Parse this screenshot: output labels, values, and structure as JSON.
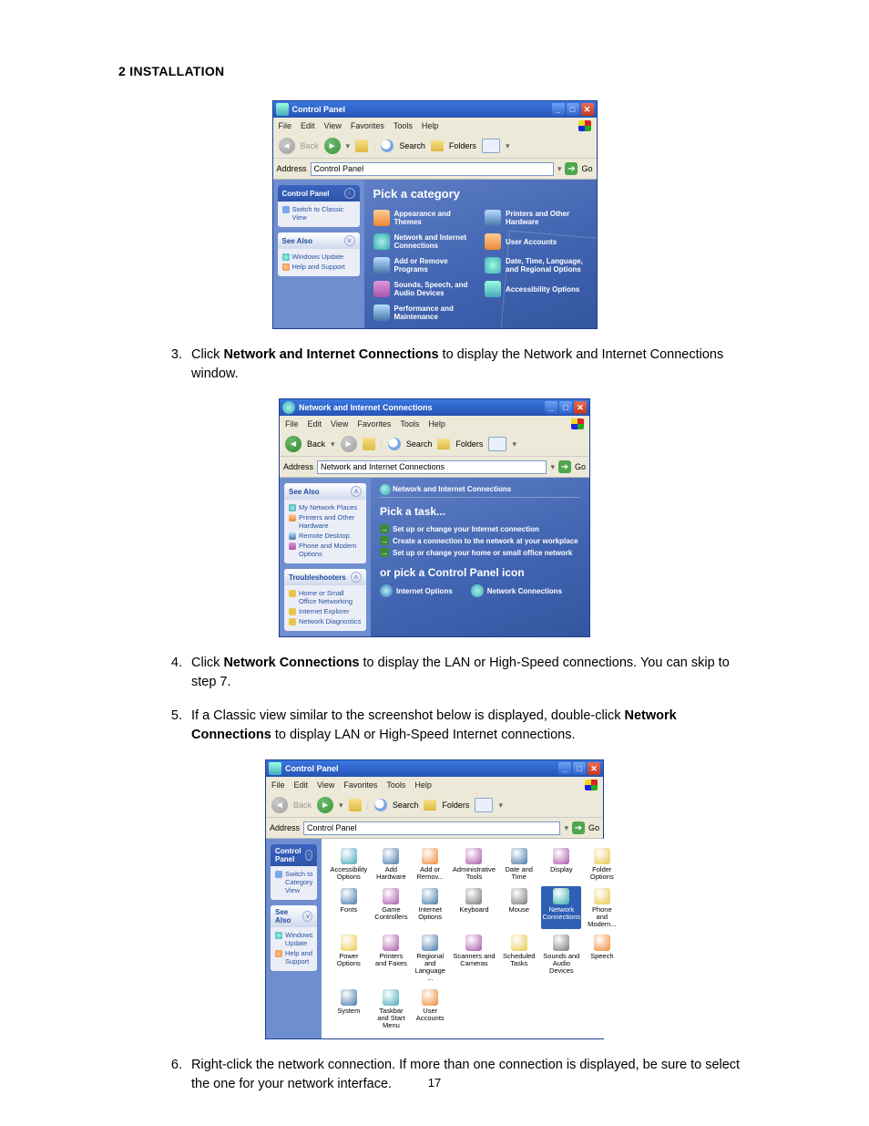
{
  "section_heading": "2 INSTALLATION",
  "page_number": "17",
  "steps": {
    "s3": {
      "num": "3.",
      "pre": "Click ",
      "bold": "Network and Internet Connections",
      "post": " to display the Network and Internet Connections window."
    },
    "s4": {
      "num": "4.",
      "pre": "Click ",
      "bold": "Network Connections",
      "post": " to display the LAN or High-Speed connections. You can skip to step 7."
    },
    "s5": {
      "num": "5.",
      "pre": "If a Classic view similar to the screenshot below is displayed, double-click ",
      "bold": "Network Connections",
      "post": " to display LAN or High-Speed Internet connections."
    },
    "s6": {
      "num": "6.",
      "text": "Right-click the network connection. If more than one connection is displayed, be sure to select the one for your network interface."
    }
  },
  "xp": {
    "menus": {
      "file": "File",
      "edit": "Edit",
      "view": "View",
      "fav": "Favorites",
      "tools": "Tools",
      "help": "Help"
    },
    "toolbar": {
      "back": "Back",
      "search": "Search",
      "folders": "Folders"
    },
    "addr_label": "Address",
    "go": "Go"
  },
  "win1": {
    "title": "Control Panel",
    "address": "Control Panel",
    "side_cp": {
      "title": "Control Panel",
      "switch": "Switch to Classic View"
    },
    "side_seealso": {
      "title": "See Also",
      "items": [
        "Windows Update",
        "Help and Support"
      ]
    },
    "main_heading": "Pick a category",
    "cats": [
      "Appearance and Themes",
      "Printers and Other Hardware",
      "Network and Internet Connections",
      "User Accounts",
      "Add or Remove Programs",
      "Date, Time, Language, and Regional Options",
      "Sounds, Speech, and Audio Devices",
      "Accessibility Options",
      "Performance and Maintenance"
    ]
  },
  "win2": {
    "title": "Network and Internet Connections",
    "address": "Network and Internet Connections",
    "side_seealso": {
      "title": "See Also",
      "items": [
        "My Network Places",
        "Printers and Other Hardware",
        "Remote Desktop",
        "Phone and Modem Options"
      ]
    },
    "side_trouble": {
      "title": "Troubleshooters",
      "items": [
        "Home or Small Office Networking",
        "Internet Explorer",
        "Network Diagnostics"
      ]
    },
    "crumb": "Network and Internet Connections",
    "h_task": "Pick a task...",
    "tasks": [
      "Set up or change your Internet connection",
      "Create a connection to the network at your workplace",
      "Set up or change your home or small office network"
    ],
    "h_icon": "or pick a Control Panel icon",
    "icons": [
      "Internet Options",
      "Network Connections"
    ]
  },
  "win3": {
    "title": "Control Panel",
    "address": "Control Panel",
    "side_cp": {
      "title": "Control Panel",
      "switch": "Switch to Category View"
    },
    "side_seealso": {
      "title": "See Also",
      "items": [
        "Windows Update",
        "Help and Support"
      ]
    },
    "items": [
      "Accessibility Options",
      "Add Hardware",
      "Add or Remov...",
      "Administrative Tools",
      "Date and Time",
      "Display",
      "Folder Options",
      "Fonts",
      "Game Controllers",
      "Internet Options",
      "Keyboard",
      "Mouse",
      "Network Connections",
      "Phone and Modem...",
      "Power Options",
      "Printers and Faxes",
      "Regional and Language ...",
      "Scanners and Cameras",
      "Scheduled Tasks",
      "Sounds and Audio Devices",
      "Speech",
      "System",
      "Taskbar and Start Menu",
      "User Accounts"
    ],
    "selected_index": 12
  }
}
